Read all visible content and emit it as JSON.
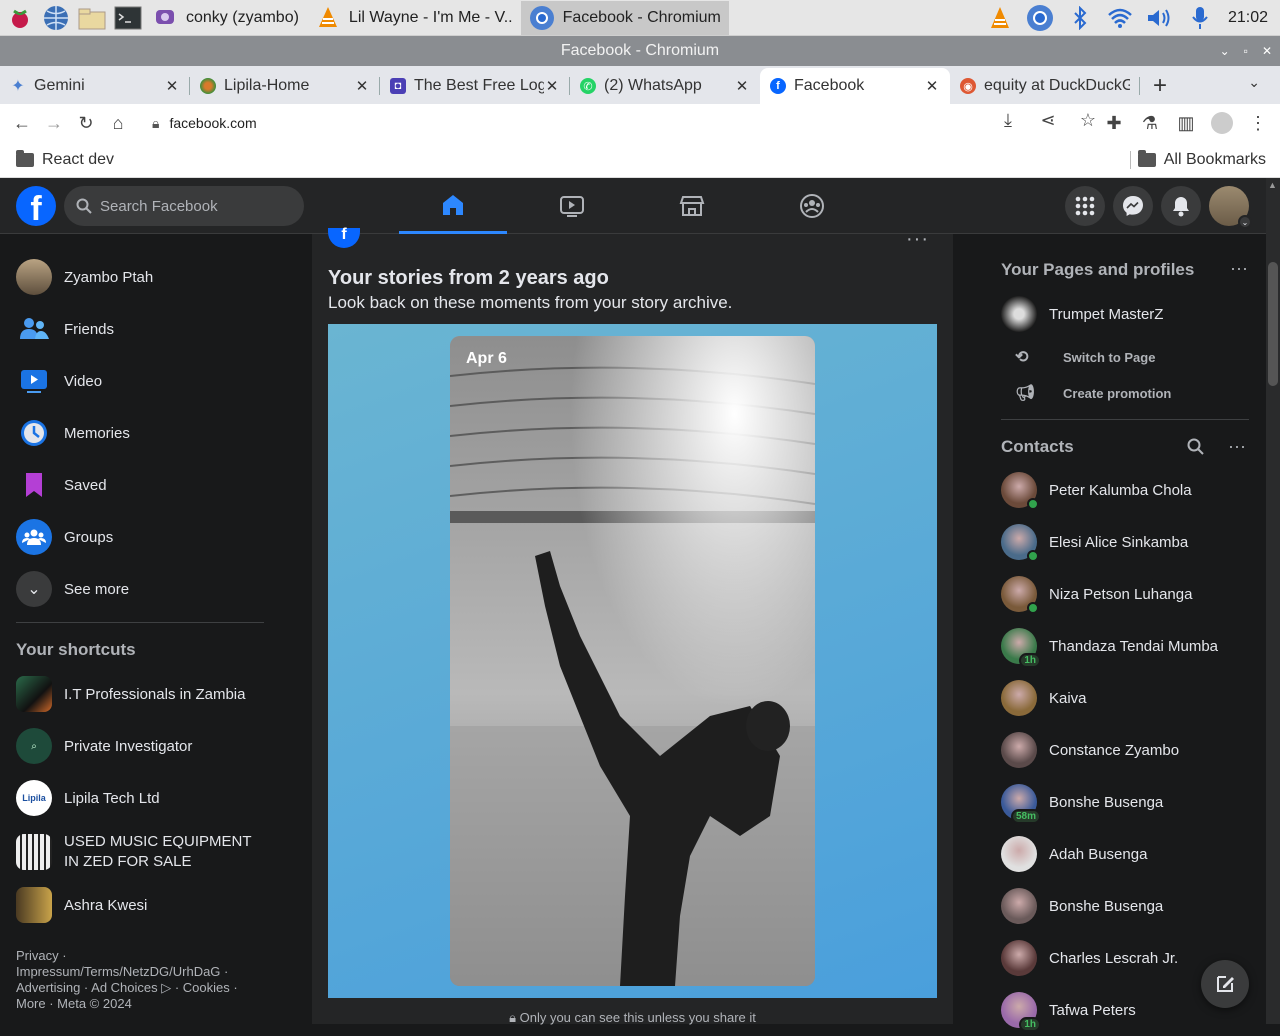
{
  "taskbar": {
    "apps": [
      {
        "label": "conky (zyambo)"
      },
      {
        "label": "Lil Wayne - I'm Me - V.."
      },
      {
        "label": "Facebook - Chromium"
      }
    ],
    "clock": "21:02"
  },
  "window": {
    "title": "Facebook - Chromium"
  },
  "tabs": [
    {
      "label": "Gemini"
    },
    {
      "label": "Lipila-Home"
    },
    {
      "label": "The Best Free Logo"
    },
    {
      "label": "(2) WhatsApp"
    },
    {
      "label": "Facebook"
    },
    {
      "label": "equity at DuckDuckGo"
    }
  ],
  "omnibox": {
    "url": "facebook.com"
  },
  "bookmarks": {
    "left": "React dev",
    "right": "All Bookmarks"
  },
  "fb": {
    "search_placeholder": "Search Facebook",
    "left": {
      "profile": "Zyambo Ptah",
      "items": [
        "Friends",
        "Video",
        "Memories",
        "Saved",
        "Groups",
        "See more"
      ],
      "shortcuts_title": "Your shortcuts",
      "shortcuts": [
        "I.T Professionals in Zambia",
        "Private Investigator",
        "Lipila Tech Ltd",
        "USED MUSIC EQUIPMENT IN ZED FOR SALE",
        "Ashra Kwesi"
      ],
      "shortcut_icon_text": "Lipila",
      "footer": "Privacy · Impressum/Terms/NetzDG/UrhDaG · Advertising · Ad Choices ▷ · Cookies · More · Meta © 2024"
    },
    "story": {
      "title": "Your stories from 2 years ago",
      "subtitle": "Look back on these moments from your story archive.",
      "date": "Apr 6",
      "privacy": "Only you can see this unless you share it"
    },
    "right": {
      "pages_title": "Your Pages and profiles",
      "page_name": "Trumpet MasterZ",
      "switch": "Switch to Page",
      "promo": "Create promotion",
      "contacts_title": "Contacts",
      "contacts": [
        {
          "name": "Peter Kalumba Chola",
          "status": "online"
        },
        {
          "name": "Elesi Alice Sinkamba",
          "status": "online"
        },
        {
          "name": "Niza Petson Luhanga",
          "status": "online"
        },
        {
          "name": "Thandaza Tendai Mumba",
          "status": "1h"
        },
        {
          "name": "Kaiva",
          "status": ""
        },
        {
          "name": "Constance Zyambo",
          "status": ""
        },
        {
          "name": "Bonshe Busenga",
          "status": "58m"
        },
        {
          "name": "Adah Busenga",
          "status": ""
        },
        {
          "name": "Bonshe Busenga",
          "status": ""
        },
        {
          "name": "Charles Lescrah Jr.",
          "status": ""
        },
        {
          "name": "Tafwa Peters",
          "status": "1h"
        }
      ]
    }
  },
  "colors": {
    "accent": "#0866ff",
    "bg": "#18191a",
    "card": "#242526",
    "online": "#31a24c"
  }
}
